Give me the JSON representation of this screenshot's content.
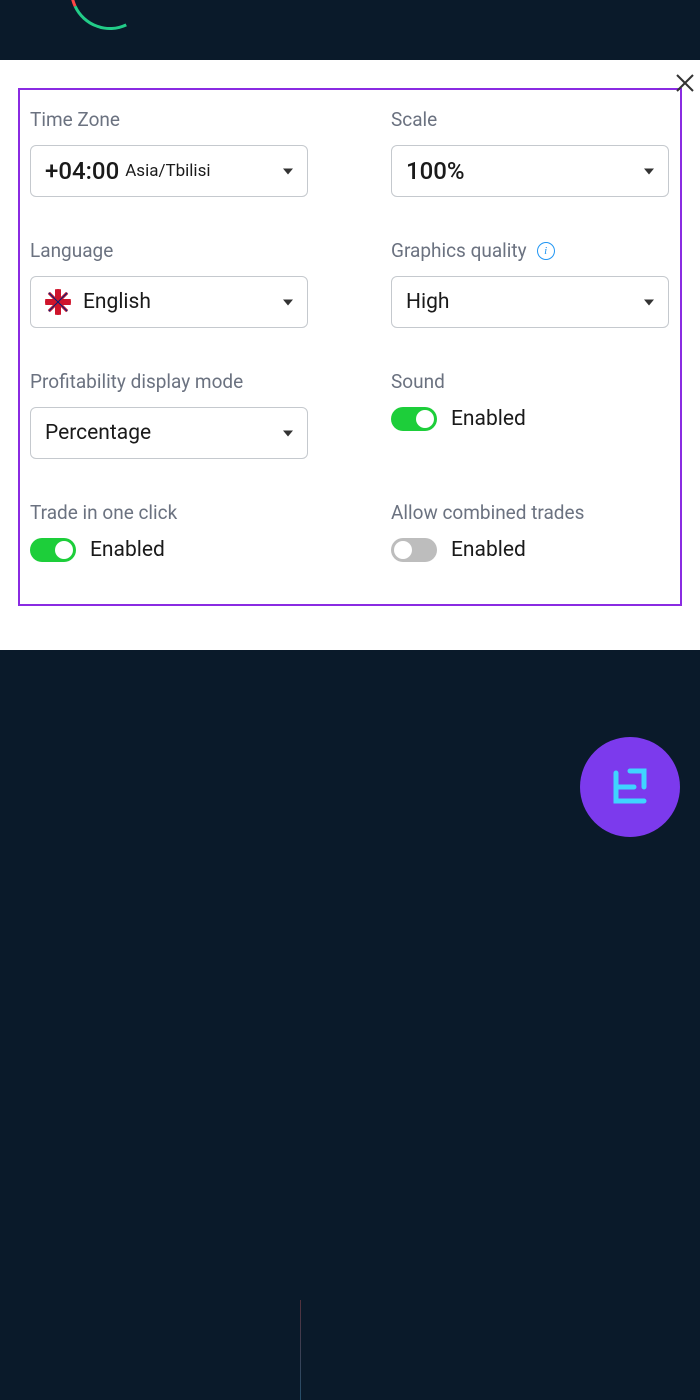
{
  "fields": {
    "timezone": {
      "label": "Time Zone",
      "value": "+04:00",
      "sub": "Asia/Tbilisi"
    },
    "scale": {
      "label": "Scale",
      "value": "100%"
    },
    "language": {
      "label": "Language",
      "value": "English"
    },
    "graphics": {
      "label": "Graphics quality",
      "value": "High"
    },
    "profitability": {
      "label": "Profitability display mode",
      "value": "Percentage"
    },
    "sound": {
      "label": "Sound",
      "status": "Enabled",
      "enabled": true
    },
    "oneclick": {
      "label": "Trade in one click",
      "status": "Enabled",
      "enabled": true
    },
    "combined": {
      "label": "Allow combined trades",
      "status": "Enabled",
      "enabled": false
    }
  }
}
